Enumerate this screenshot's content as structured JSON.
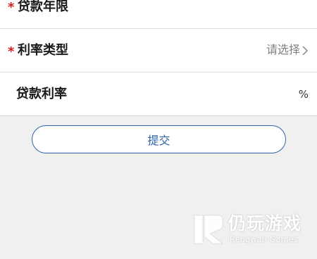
{
  "form": {
    "loan_term": {
      "required_mark": "*",
      "label": "贷款年限"
    },
    "rate_type": {
      "required_mark": "*",
      "label": "利率类型",
      "placeholder": "请选择"
    },
    "loan_rate": {
      "label": "贷款利率",
      "unit": "%"
    }
  },
  "submit": {
    "label": "提交"
  },
  "watermark": {
    "cn": "仍玩游戏",
    "en": "Rengwan Games"
  },
  "colors": {
    "required": "#d42020",
    "accent": "#2f63a8",
    "background": "#f0f0f0"
  },
  "icons": {
    "select_arrow": "chevron-right-icon"
  }
}
